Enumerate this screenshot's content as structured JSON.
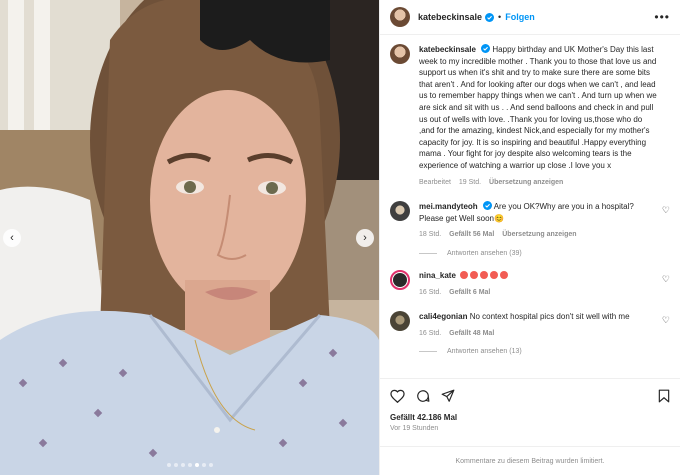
{
  "post": {
    "username": "katebeckinsale",
    "separator": "•",
    "follow_label": "Folgen",
    "more_label": "•••",
    "caption": "Happy birthday and UK Mother's Day this last week to my incredible mother . Thank you to those that love us and support us when it's shit and try to make sure there are some bits that aren't . And for looking after our dogs when we can't , and lead us to remember happy things when we can't . And turn up when we are sick and sit with us . . And send balloons and check in and pull us out of wells with love. .Thank you for loving us,those who do ,and for the amazing, kindest Nick,and especially for my mother's capacity for joy. It is so inspiring and beautiful .Happy everything mama . Your fight for joy despite also welcoming tears is the experience of watching a warrior up close .I love you x",
    "caption_meta": {
      "edited": "Bearbeitet",
      "time": "19 Std.",
      "translate": "Übersetzung anzeigen"
    }
  },
  "comments": [
    {
      "username": "mei.mandyteoh",
      "text": "Are you OK?Why are you in a hospital? Please get Well soon😊",
      "time": "18 Std.",
      "likes": "Gefällt 56 Mal",
      "translate": "Übersetzung anzeigen",
      "replies": "Antworten ansehen (39)"
    },
    {
      "username": "nina_kate",
      "text": "",
      "time": "16 Std.",
      "likes": "Gefällt 6 Mal"
    },
    {
      "username": "cali4egonian",
      "text": "No context hospital pics don't sit well with me",
      "time": "16 Std.",
      "likes": "Gefällt 48 Mal",
      "replies": "Antworten ansehen (13)"
    }
  ],
  "footer": {
    "likes": "Gefällt 42.186 Mal",
    "time": "Vor 19 Stunden",
    "comments_limited": "Kommentare zu diesem Beitrag wurden limitiert."
  },
  "carousel": {
    "count": 7,
    "active": 4
  },
  "colors": {
    "link": "#0095f6",
    "verified": "#0095f6",
    "muted": "#8e8e8e",
    "text": "#262626"
  },
  "icons": [
    "verified-icon",
    "more-icon",
    "heart-icon",
    "comment-icon",
    "share-icon",
    "bookmark-icon",
    "chevron-left-icon",
    "chevron-right-icon"
  ]
}
